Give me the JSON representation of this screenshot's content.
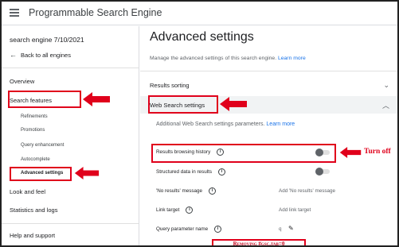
{
  "app": {
    "title": "Programmable Search Engine"
  },
  "sidebar": {
    "engine_name": "search engine 7/10/2021",
    "back_label": "Back to all engines",
    "overview": "Overview",
    "search_features": "Search features",
    "sub_items": [
      "Refinements",
      "Promotions",
      "Query enhancement",
      "Autocomplete",
      "Advanced settings"
    ],
    "look_and_feel": "Look and feel",
    "stats_logs": "Statistics and logs",
    "help": "Help and support"
  },
  "main": {
    "title": "Advanced settings",
    "description": "Manage the advanced settings of this search engine.",
    "learn_more": "Learn more",
    "results_sorting": "Results sorting",
    "web_search_settings": "Web Search settings",
    "web_desc": "Additional Web Search settings parameters.",
    "web_learn_more": "Learn more",
    "rows": {
      "results_history": {
        "label": "Results browsing history",
        "toggle_on": false
      },
      "structured_data": {
        "label": "Structured data in results",
        "toggle_on": false
      },
      "no_results": {
        "label": "'No results' message",
        "value": "Add 'No results' message"
      },
      "link_target": {
        "label": "Link target",
        "value": "Add link target"
      },
      "query_param": {
        "label": "Query parameter name",
        "value": "q"
      }
    }
  },
  "annotations": {
    "turn_off": "Turn off",
    "removing": "Removing #gsc.tab=0",
    "accent": "#e0001b"
  },
  "icons": {
    "info": "info-icon",
    "pencil": "pencil-icon",
    "back": "arrow-left-icon",
    "menu": "hamburger-icon"
  }
}
